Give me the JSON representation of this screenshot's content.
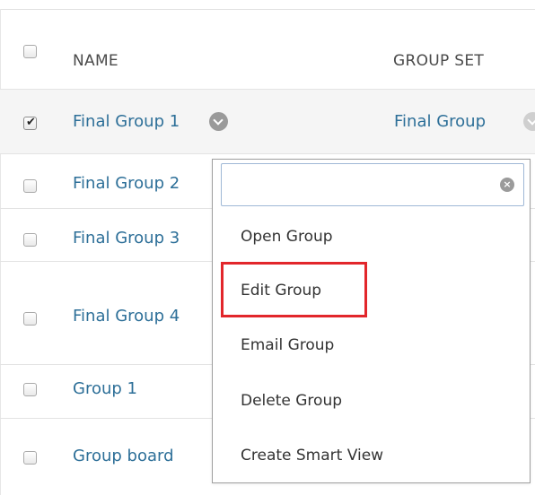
{
  "table": {
    "headers": {
      "name": "NAME",
      "group_set": "GROUP SET"
    },
    "rows": [
      {
        "name": "Final Group 1",
        "checked": true,
        "group_set": "Final Group"
      },
      {
        "name": "Final Group 2",
        "checked": false
      },
      {
        "name": "Final Group 3",
        "checked": false
      },
      {
        "name": "Final Group 4",
        "checked": false
      },
      {
        "name": "Group 1",
        "checked": false
      },
      {
        "name": "Group board",
        "checked": false
      }
    ]
  },
  "popup": {
    "search_value": "",
    "items": [
      {
        "label": "Open Group"
      },
      {
        "label": "Edit Group",
        "highlighted": true
      },
      {
        "label": "Email Group"
      },
      {
        "label": "Delete Group"
      },
      {
        "label": "Create Smart View"
      }
    ]
  },
  "icons": {
    "checkmark": "checkmark-icon",
    "chevron": "chevron-down-icon",
    "clear": "clear-icon"
  },
  "colors": {
    "link": "#2d6f98",
    "highlight_box": "#e2262b",
    "selected_row_bg": "#f5f5f5"
  }
}
